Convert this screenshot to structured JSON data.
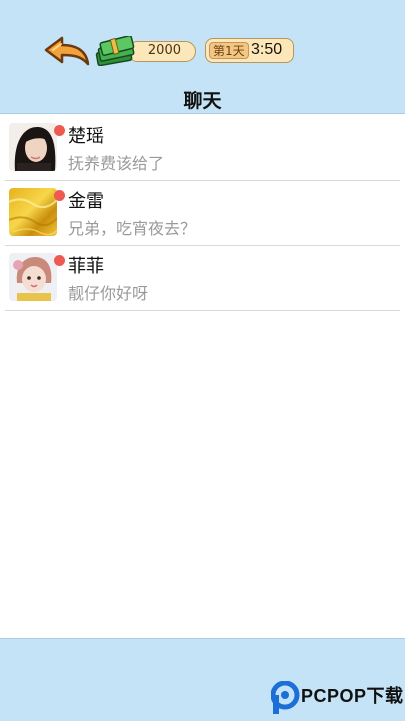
{
  "header": {
    "money": "2000",
    "day": "第1天",
    "time": "3:50",
    "title": "聊天"
  },
  "chats": [
    {
      "name": "楚瑶",
      "preview": "抚养费该给了",
      "unread": true,
      "avatar": "woman-portrait"
    },
    {
      "name": "金雷",
      "preview": "兄弟，吃宵夜去？",
      "unread": true,
      "avatar": "gold-texture"
    },
    {
      "name": "菲菲",
      "preview": "靓仔你好呀",
      "unread": true,
      "avatar": "girl-portrait"
    }
  ],
  "watermark": {
    "brand": "PCPOP下载"
  },
  "colors": {
    "bar_bg": "#c4e3f6",
    "unread_dot": "#ee5a52",
    "pill_bg": "#fbe7b9"
  }
}
